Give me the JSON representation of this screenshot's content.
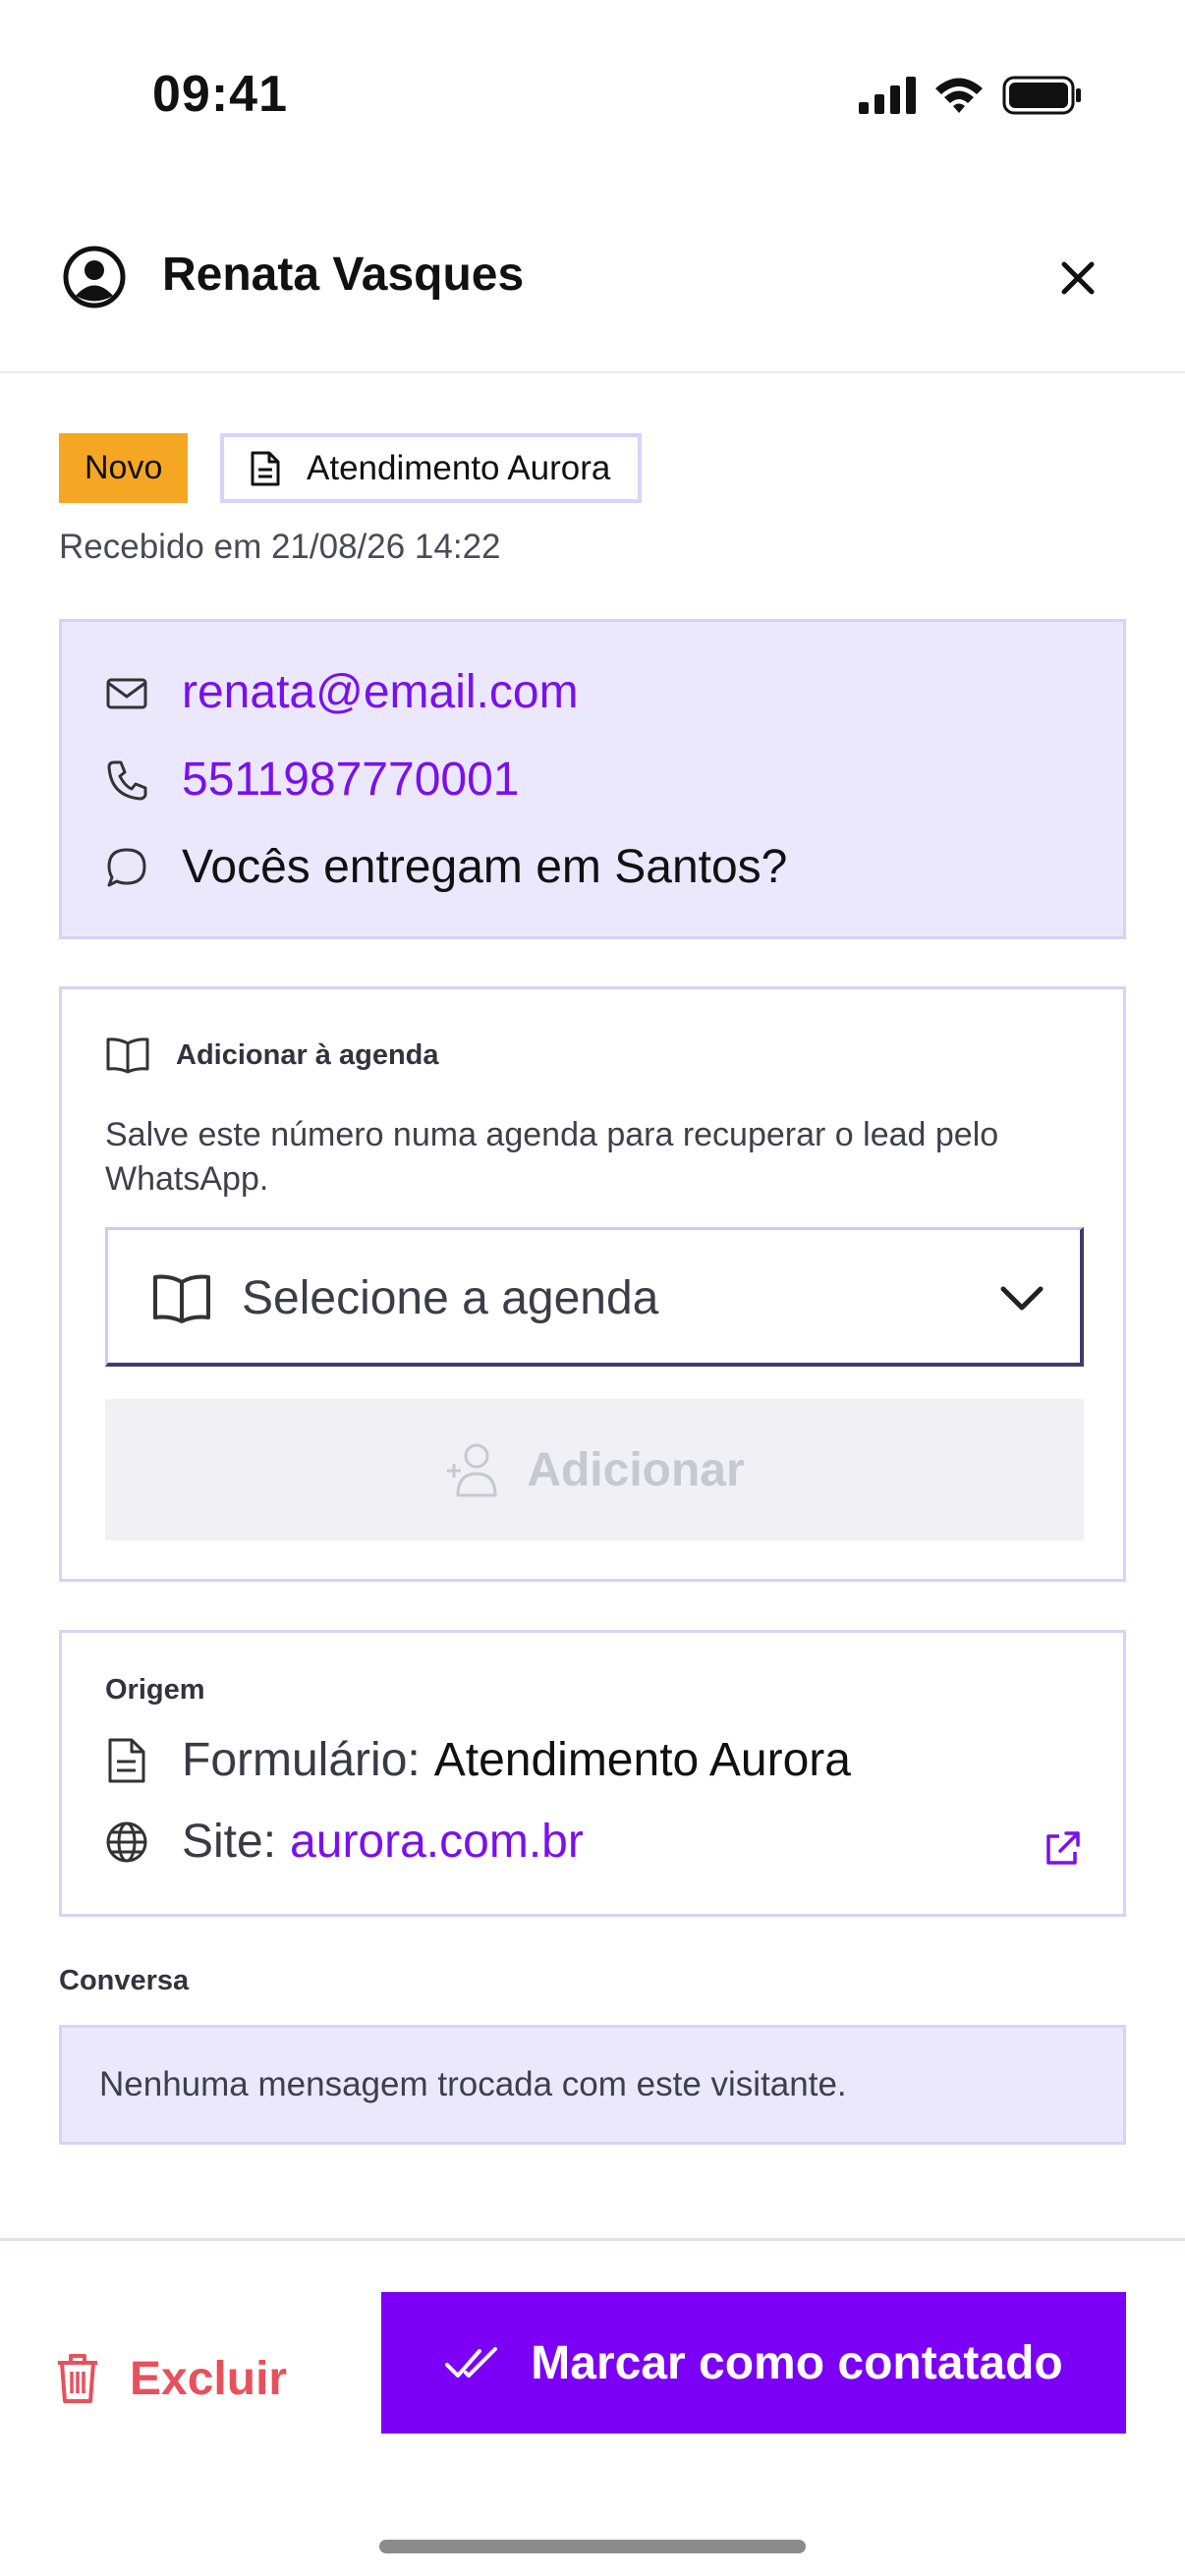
{
  "status_bar": {
    "time": "09:41"
  },
  "header": {
    "title": "Renata Vasques"
  },
  "badges": {
    "status": "Novo",
    "form": "Atendimento Aurora"
  },
  "received": "Recebido em 21/08/26 14:22",
  "contact": {
    "email": "renata@email.com",
    "phone": "5511987770001",
    "message": "Vocês entregam em Santos?"
  },
  "agenda": {
    "title": "Adicionar à agenda",
    "description": "Salve este número numa agenda para recuperar o lead pelo WhatsApp.",
    "select_placeholder": "Selecione a agenda",
    "add_label": "Adicionar"
  },
  "origin": {
    "title": "Origem",
    "form_key": "Formulário:",
    "form_value": "Atendimento Aurora",
    "site_key": "Site:",
    "site_value": "aurora.com.br"
  },
  "conversation": {
    "title": "Conversa",
    "empty_text": "Nenhuma mensagem trocada com este visitante."
  },
  "footer": {
    "delete_label": "Excluir",
    "primary_label": "Marcar como contatado"
  },
  "colors": {
    "accent": "#7b00f5",
    "link": "#7a10ee",
    "danger": "#e8505b",
    "badge_new": "#f5a623",
    "card_tint": "#ebe8fd"
  },
  "icons": [
    "user-circle-icon",
    "close-icon",
    "document-icon",
    "mail-icon",
    "phone-icon",
    "chat-bubble-icon",
    "book-icon",
    "chevron-down-icon",
    "add-user-icon",
    "globe-icon",
    "external-link-icon",
    "trash-icon",
    "double-check-icon"
  ]
}
